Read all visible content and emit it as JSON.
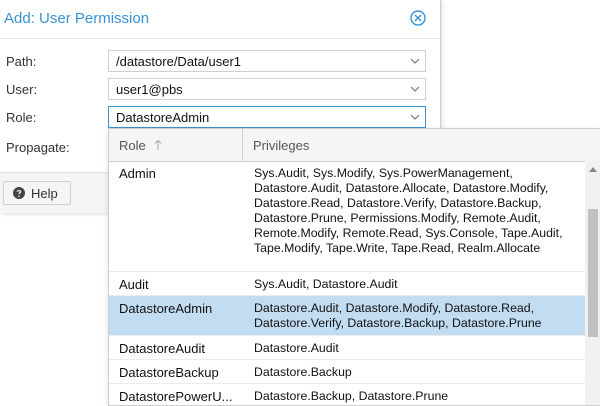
{
  "dialog": {
    "title": "Add: User Permission",
    "fields": {
      "path": {
        "label": "Path:",
        "value": "/datastore/Data/user1"
      },
      "user": {
        "label": "User:",
        "value": "user1@pbs"
      },
      "role": {
        "label": "Role:",
        "value": "DatastoreAdmin"
      },
      "propagate": {
        "label": "Propagate:"
      }
    },
    "help_label": "Help"
  },
  "grid": {
    "columns": {
      "role": "Role",
      "privileges": "Privileges"
    },
    "sort": {
      "column": "role",
      "direction": "ascending"
    },
    "rows": [
      {
        "role": "Admin",
        "privileges": "Sys.Audit, Sys.Modify, Sys.PowerManagement, Datastore.Audit, Datastore.Allocate, Datastore.Modify, Datastore.Read, Datastore.Verify, Datastore.Backup, Datastore.Prune, Permissions.Modify, Remote.Audit, Remote.Modify, Remote.Read, Sys.Console, Tape.Audit, Tape.Modify, Tape.Write, Tape.Read, Realm.Allocate"
      },
      {
        "role": "Audit",
        "privileges": "Sys.Audit, Datastore.Audit"
      },
      {
        "role": "DatastoreAdmin",
        "privileges": "Datastore.Audit, Datastore.Modify, Datastore.Read, Datastore.Verify, Datastore.Backup, Datastore.Prune"
      },
      {
        "role": "DatastoreAudit",
        "privileges": "Datastore.Audit"
      },
      {
        "role": "DatastoreBackup",
        "privileges": "Datastore.Backup"
      },
      {
        "role": "DatastorePowerU...",
        "privileges": "Datastore.Backup, Datastore.Prune"
      }
    ],
    "selected_index": 2
  },
  "colors": {
    "accent": "#3892d4",
    "selected_row": "#c2ddf2"
  }
}
